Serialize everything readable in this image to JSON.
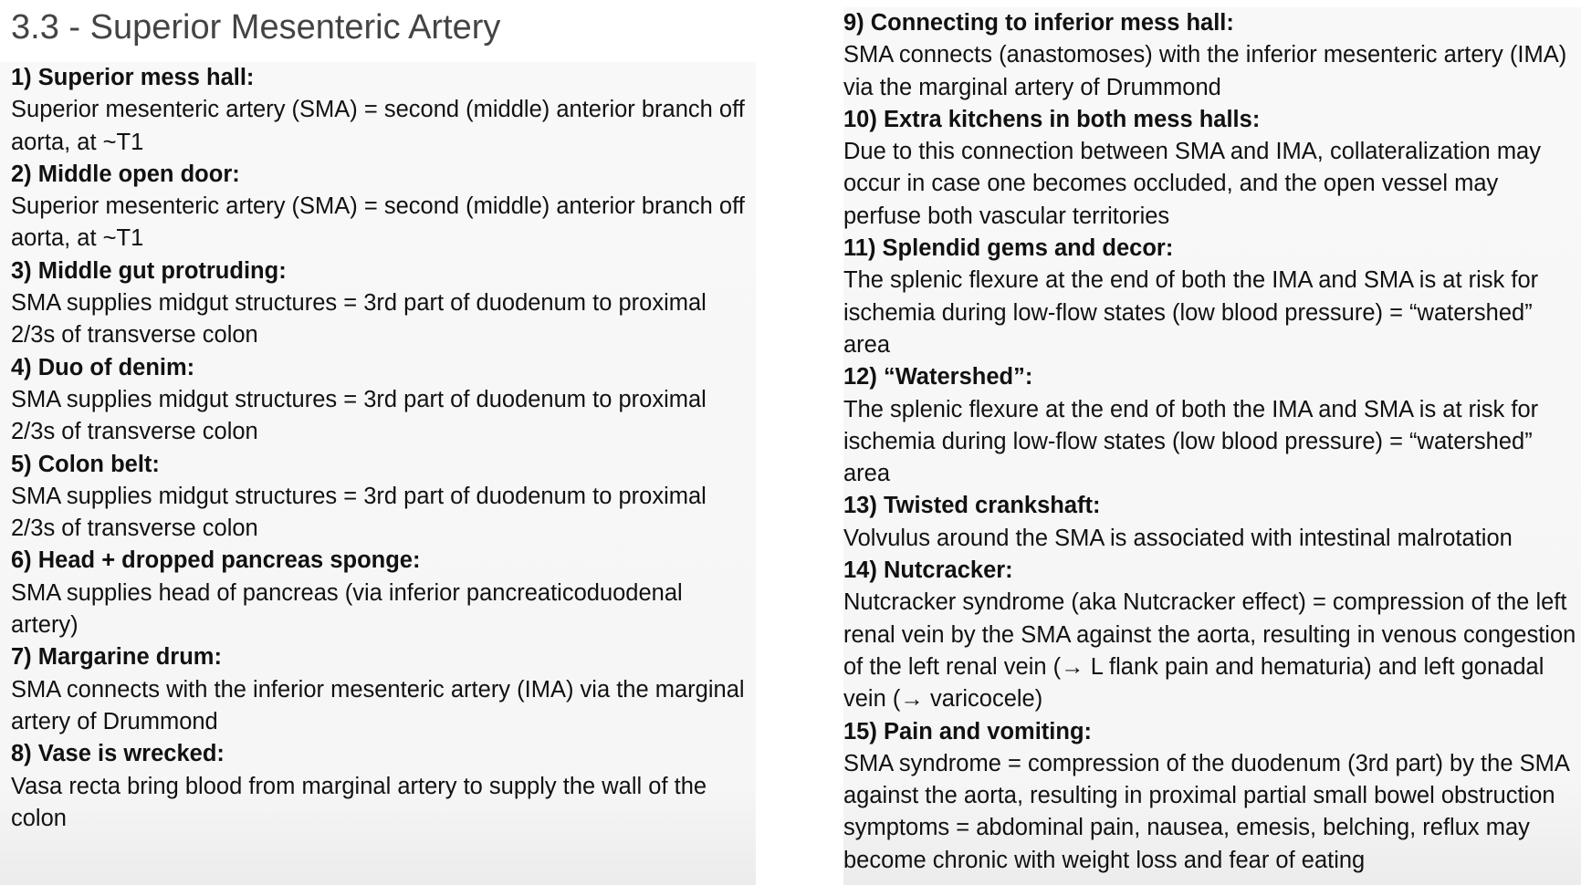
{
  "page_title": "3.3 - Superior Mesenteric Artery",
  "left_entries": [
    {
      "heading": "1) Superior mess hall:",
      "body": "Superior mesenteric artery (SMA) = second (middle) anterior branch off aorta, at ~T1"
    },
    {
      "heading": "2) Middle open door:",
      "body": "Superior mesenteric artery (SMA) = second (middle) anterior branch off aorta, at ~T1"
    },
    {
      "heading": "3) Middle gut protruding:",
      "body": "SMA supplies midgut structures = 3rd part of duodenum to proximal 2/3s of transverse colon"
    },
    {
      "heading": "4) Duo of denim:",
      "body": "SMA supplies midgut structures = 3rd part of duodenum to proximal 2/3s of transverse colon"
    },
    {
      "heading": "5) Colon belt:",
      "body": "SMA supplies midgut structures = 3rd part of duodenum to proximal 2/3s of transverse colon"
    },
    {
      "heading": "6) Head + dropped pancreas sponge:",
      "body": "SMA supplies head of pancreas (via inferior pancreaticoduodenal artery)"
    },
    {
      "heading": "7) Margarine drum:",
      "body": "SMA connects with the inferior mesenteric artery (IMA) via the marginal artery of Drummond"
    },
    {
      "heading": "8) Vase is wrecked:",
      "body": "Vasa recta bring blood from marginal artery to supply the wall of the colon"
    }
  ],
  "right_entries": [
    {
      "heading": "9) Connecting to inferior mess hall:",
      "body": "SMA connects (anastomoses) with the inferior mesenteric artery (IMA) via the marginal artery of Drummond"
    },
    {
      "heading": "10) Extra kitchens in both mess halls:",
      "body": "Due to this connection between SMA and IMA, collateralization may occur in case one becomes occluded, and the open vessel may perfuse both vascular territories"
    },
    {
      "heading": "11) Splendid gems and decor:",
      "body": "The splenic flexure at the end of both the IMA and SMA is at risk for ischemia during low-flow states (low blood pressure) = “watershed” area"
    },
    {
      "heading": "12) “Watershed”:",
      "body": "The splenic flexure at the end of both the IMA and SMA is at risk for ischemia during low-flow states (low blood pressure) = “watershed” area"
    },
    {
      "heading": "13) Twisted crankshaft:",
      "body": "Volvulus around the SMA is associated with intestinal malrotation"
    },
    {
      "heading": "14) Nutcracker:",
      "body": "Nutcracker syndrome (aka Nutcracker effect) = compression of the left renal vein by the SMA against the aorta, resulting in venous congestion of the left renal vein (→ L flank pain and hematuria) and left gonadal vein (→ varicocele)"
    },
    {
      "heading": "15) Pain and vomiting:",
      "body": "SMA syndrome = compression of the duodenum (3rd part) by the SMA against the aorta, resulting in proximal partial small bowel obstruction symptoms = abdominal pain, nausea, emesis, belching, reflux may become chronic with weight loss and fear of eating"
    }
  ]
}
